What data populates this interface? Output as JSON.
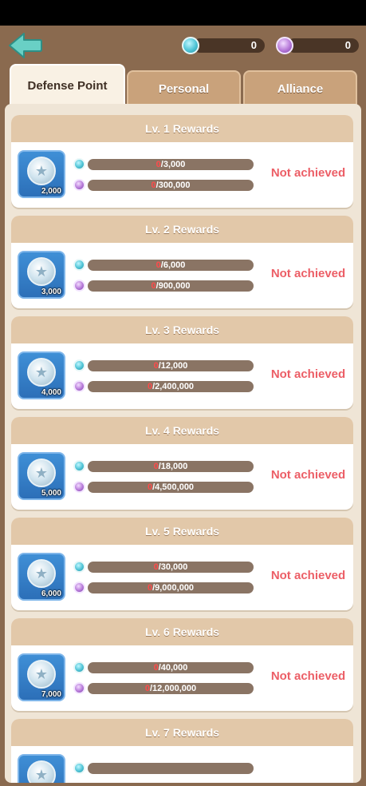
{
  "header": {
    "back_icon": "back-arrow-icon",
    "currencies": [
      {
        "name": "teal-coin-icon",
        "value": "0",
        "color": "#4fc4d6"
      },
      {
        "name": "purple-coin-icon",
        "value": "0",
        "color": "#b77ad9"
      }
    ]
  },
  "tabs": [
    {
      "label": "Defense Point",
      "active": true
    },
    {
      "label": "Personal",
      "active": false
    },
    {
      "label": "Alliance",
      "active": false
    }
  ],
  "rewards": [
    {
      "title": "Lv. 1 Rewards",
      "amount": "2,000",
      "teal_current": "0",
      "teal_target": "/3,000",
      "purple_current": "0",
      "purple_target": "/300,000",
      "status": "Not achieved"
    },
    {
      "title": "Lv. 2 Rewards",
      "amount": "3,000",
      "teal_current": "0",
      "teal_target": "/6,000",
      "purple_current": "0",
      "purple_target": "/900,000",
      "status": "Not achieved"
    },
    {
      "title": "Lv. 3 Rewards",
      "amount": "4,000",
      "teal_current": "0",
      "teal_target": "/12,000",
      "purple_current": "0",
      "purple_target": "/2,400,000",
      "status": "Not achieved"
    },
    {
      "title": "Lv. 4 Rewards",
      "amount": "5,000",
      "teal_current": "0",
      "teal_target": "/18,000",
      "purple_current": "0",
      "purple_target": "/4,500,000",
      "status": "Not achieved"
    },
    {
      "title": "Lv. 5 Rewards",
      "amount": "6,000",
      "teal_current": "0",
      "teal_target": "/30,000",
      "purple_current": "0",
      "purple_target": "/9,000,000",
      "status": "Not achieved"
    },
    {
      "title": "Lv. 6 Rewards",
      "amount": "7,000",
      "teal_current": "0",
      "teal_target": "/40,000",
      "purple_current": "0",
      "purple_target": "/12,000,000",
      "status": "Not achieved"
    },
    {
      "title": "Lv. 7 Rewards"
    }
  ]
}
